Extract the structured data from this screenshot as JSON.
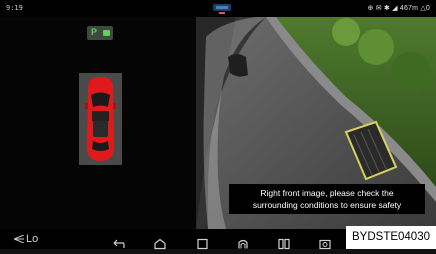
{
  "statusbar": {
    "time": "9:19",
    "right_status": "⊕ ✉ ✱ ◢ 467m △0",
    "logo_icon": "brand-logo-icon"
  },
  "left_panel": {
    "gear_badge": {
      "label": "P",
      "icon": "car-dot-icon",
      "color": "#5ed05e"
    },
    "car_color": "#e01a1a"
  },
  "camera": {
    "view": "right-front",
    "caption_line1": "Right front image, please check the",
    "caption_line2": "surrounding conditions to ensure safety"
  },
  "navbar": {
    "volume_label": "Lo",
    "items": [
      {
        "name": "back",
        "icon": "back-arrow-icon"
      },
      {
        "name": "home",
        "icon": "home-icon"
      },
      {
        "name": "recent",
        "icon": "square-icon"
      },
      {
        "name": "radar",
        "icon": "radar-icon"
      },
      {
        "name": "split",
        "icon": "split-view-icon"
      },
      {
        "name": "camera",
        "icon": "camera-icon"
      }
    ]
  },
  "watermark": "BYDSTE04030"
}
